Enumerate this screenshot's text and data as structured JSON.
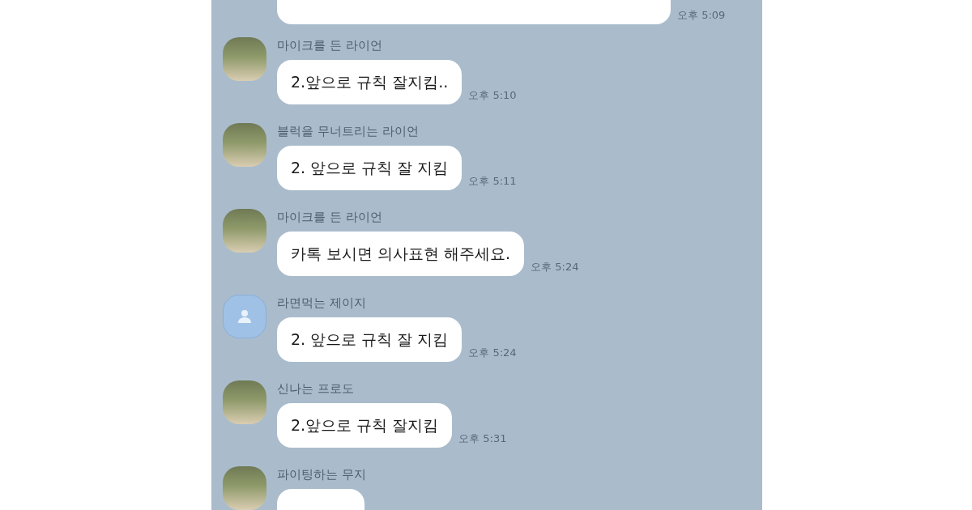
{
  "messages": [
    {
      "kind": "cut_top",
      "time": "오후 5:09"
    },
    {
      "kind": "message",
      "avatar": {
        "kind": "photo"
      },
      "sender": "마이크를 든 라이언",
      "text": "2.앞으로 규칙 잘지킴..",
      "time": "오후 5:10"
    },
    {
      "kind": "message",
      "avatar": {
        "kind": "photo"
      },
      "sender": "블럭을 무너트리는 라이언",
      "text": "2. 앞으로 규칙 잘 지킴",
      "time": "오후 5:11"
    },
    {
      "kind": "message",
      "avatar": {
        "kind": "photo"
      },
      "sender": "마이크를 든 라이언",
      "text": "카톡 보시면 의사표현 해주세요.",
      "time": "오후 5:24"
    },
    {
      "kind": "message",
      "avatar": {
        "kind": "default"
      },
      "sender": "라면먹는 제이지",
      "text": "2. 앞으로 규칙 잘 지킴",
      "time": "오후 5:24"
    },
    {
      "kind": "message",
      "avatar": {
        "kind": "photo"
      },
      "sender": "신나는 프로도",
      "text": "2.앞으로 규칙 잘지킴",
      "time": "오후 5:31"
    },
    {
      "kind": "cut_bottom",
      "avatar": {
        "kind": "photo"
      },
      "sender": "파이팅하는 무지"
    }
  ]
}
